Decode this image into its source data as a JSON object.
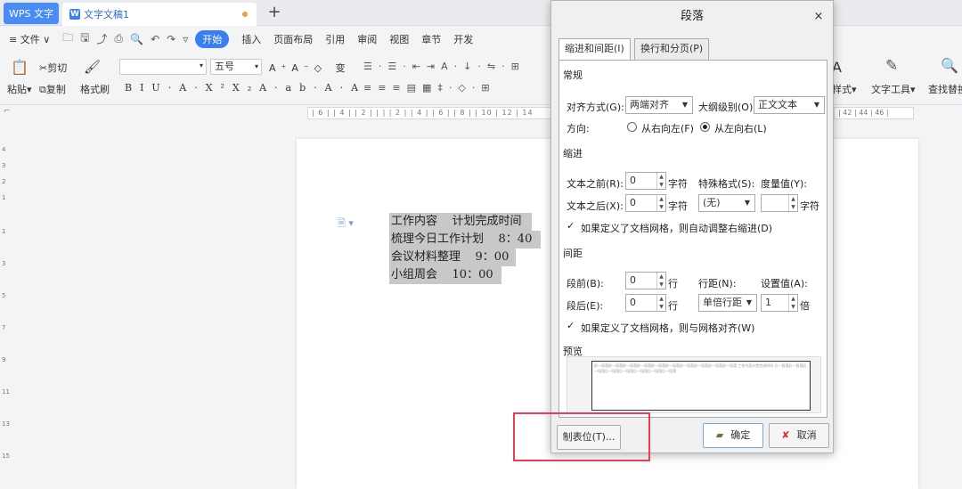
{
  "titlebar": {
    "app_tab": "WPS 文字",
    "doc_tab": "文字文稿1",
    "add_tab": "+"
  },
  "menu": {
    "file": "≡ 文件 ∨",
    "tabs": [
      "开始",
      "插入",
      "页面布局",
      "引用",
      "审阅",
      "视图",
      "章节",
      "开发"
    ]
  },
  "ribbon": {
    "paste": "粘贴",
    "cut": "剪切",
    "copy": "复制",
    "format_painter": "格式刷",
    "font_size": "五号",
    "styles": "样式",
    "text_tools": "文字工具",
    "find_replace": "查找替换"
  },
  "ruler": {
    "marks": "| 6 |  | 4 |  | 2 |  |  |  | 2 |  | 4 |  | 6 |  | 8 |  | 10 | 12 | 14",
    "marks_right": "| 42 | 44 | 46 |"
  },
  "document": {
    "lines": [
      "工作内容    计划完成时间",
      "梳理今日工作计划    8：40",
      "会议材料整理    9：00",
      "小组周会    10：00"
    ]
  },
  "dialog": {
    "title": "段落",
    "close": "×",
    "tabs": [
      "缩进和间距(I)",
      "换行和分页(P)"
    ],
    "general": {
      "section": "常规",
      "alignment_label": "对齐方式(G):",
      "alignment_value": "两端对齐",
      "outline_label": "大纲级别(O):",
      "outline_value": "正文文本",
      "direction_label": "方向:",
      "rtl": "从右向左(F)",
      "ltr": "从左向右(L)"
    },
    "indent": {
      "section": "缩进",
      "before_label": "文本之前(R):",
      "before_value": "0",
      "before_unit": "字符",
      "special_label": "特殊格式(S):",
      "measure_label": "度量值(Y):",
      "after_label": "文本之后(X):",
      "after_value": "0",
      "after_unit": "字符",
      "special_value": "(无)",
      "measure_unit": "字符",
      "auto_adjust": "如果定义了文档网格，则自动调整右缩进(D)"
    },
    "spacing": {
      "section": "间距",
      "before_label": "段前(B):",
      "before_value": "0",
      "before_unit": "行",
      "line_spacing_label": "行距(N):",
      "set_value_label": "设置值(A):",
      "after_label": "段后(E):",
      "after_value": "0",
      "after_unit": "行",
      "line_spacing_value": "单倍行距",
      "set_value": "1",
      "set_unit": "倍",
      "snap_grid": "如果定义了文档网格，则与网格对齐(W)"
    },
    "preview": {
      "section": "预览",
      "sample": "前一段落前一段落前一段落前一段落前一段落前一段落前一段落前一段落前一段落前一段落 工作内容计划完成时间 后一段落后一段落后一段落后一段落后一段落后一段落后一段落后一段落"
    },
    "buttons": {
      "tabs": "制表位(T)...",
      "ok": "确定",
      "cancel": "取消"
    }
  }
}
